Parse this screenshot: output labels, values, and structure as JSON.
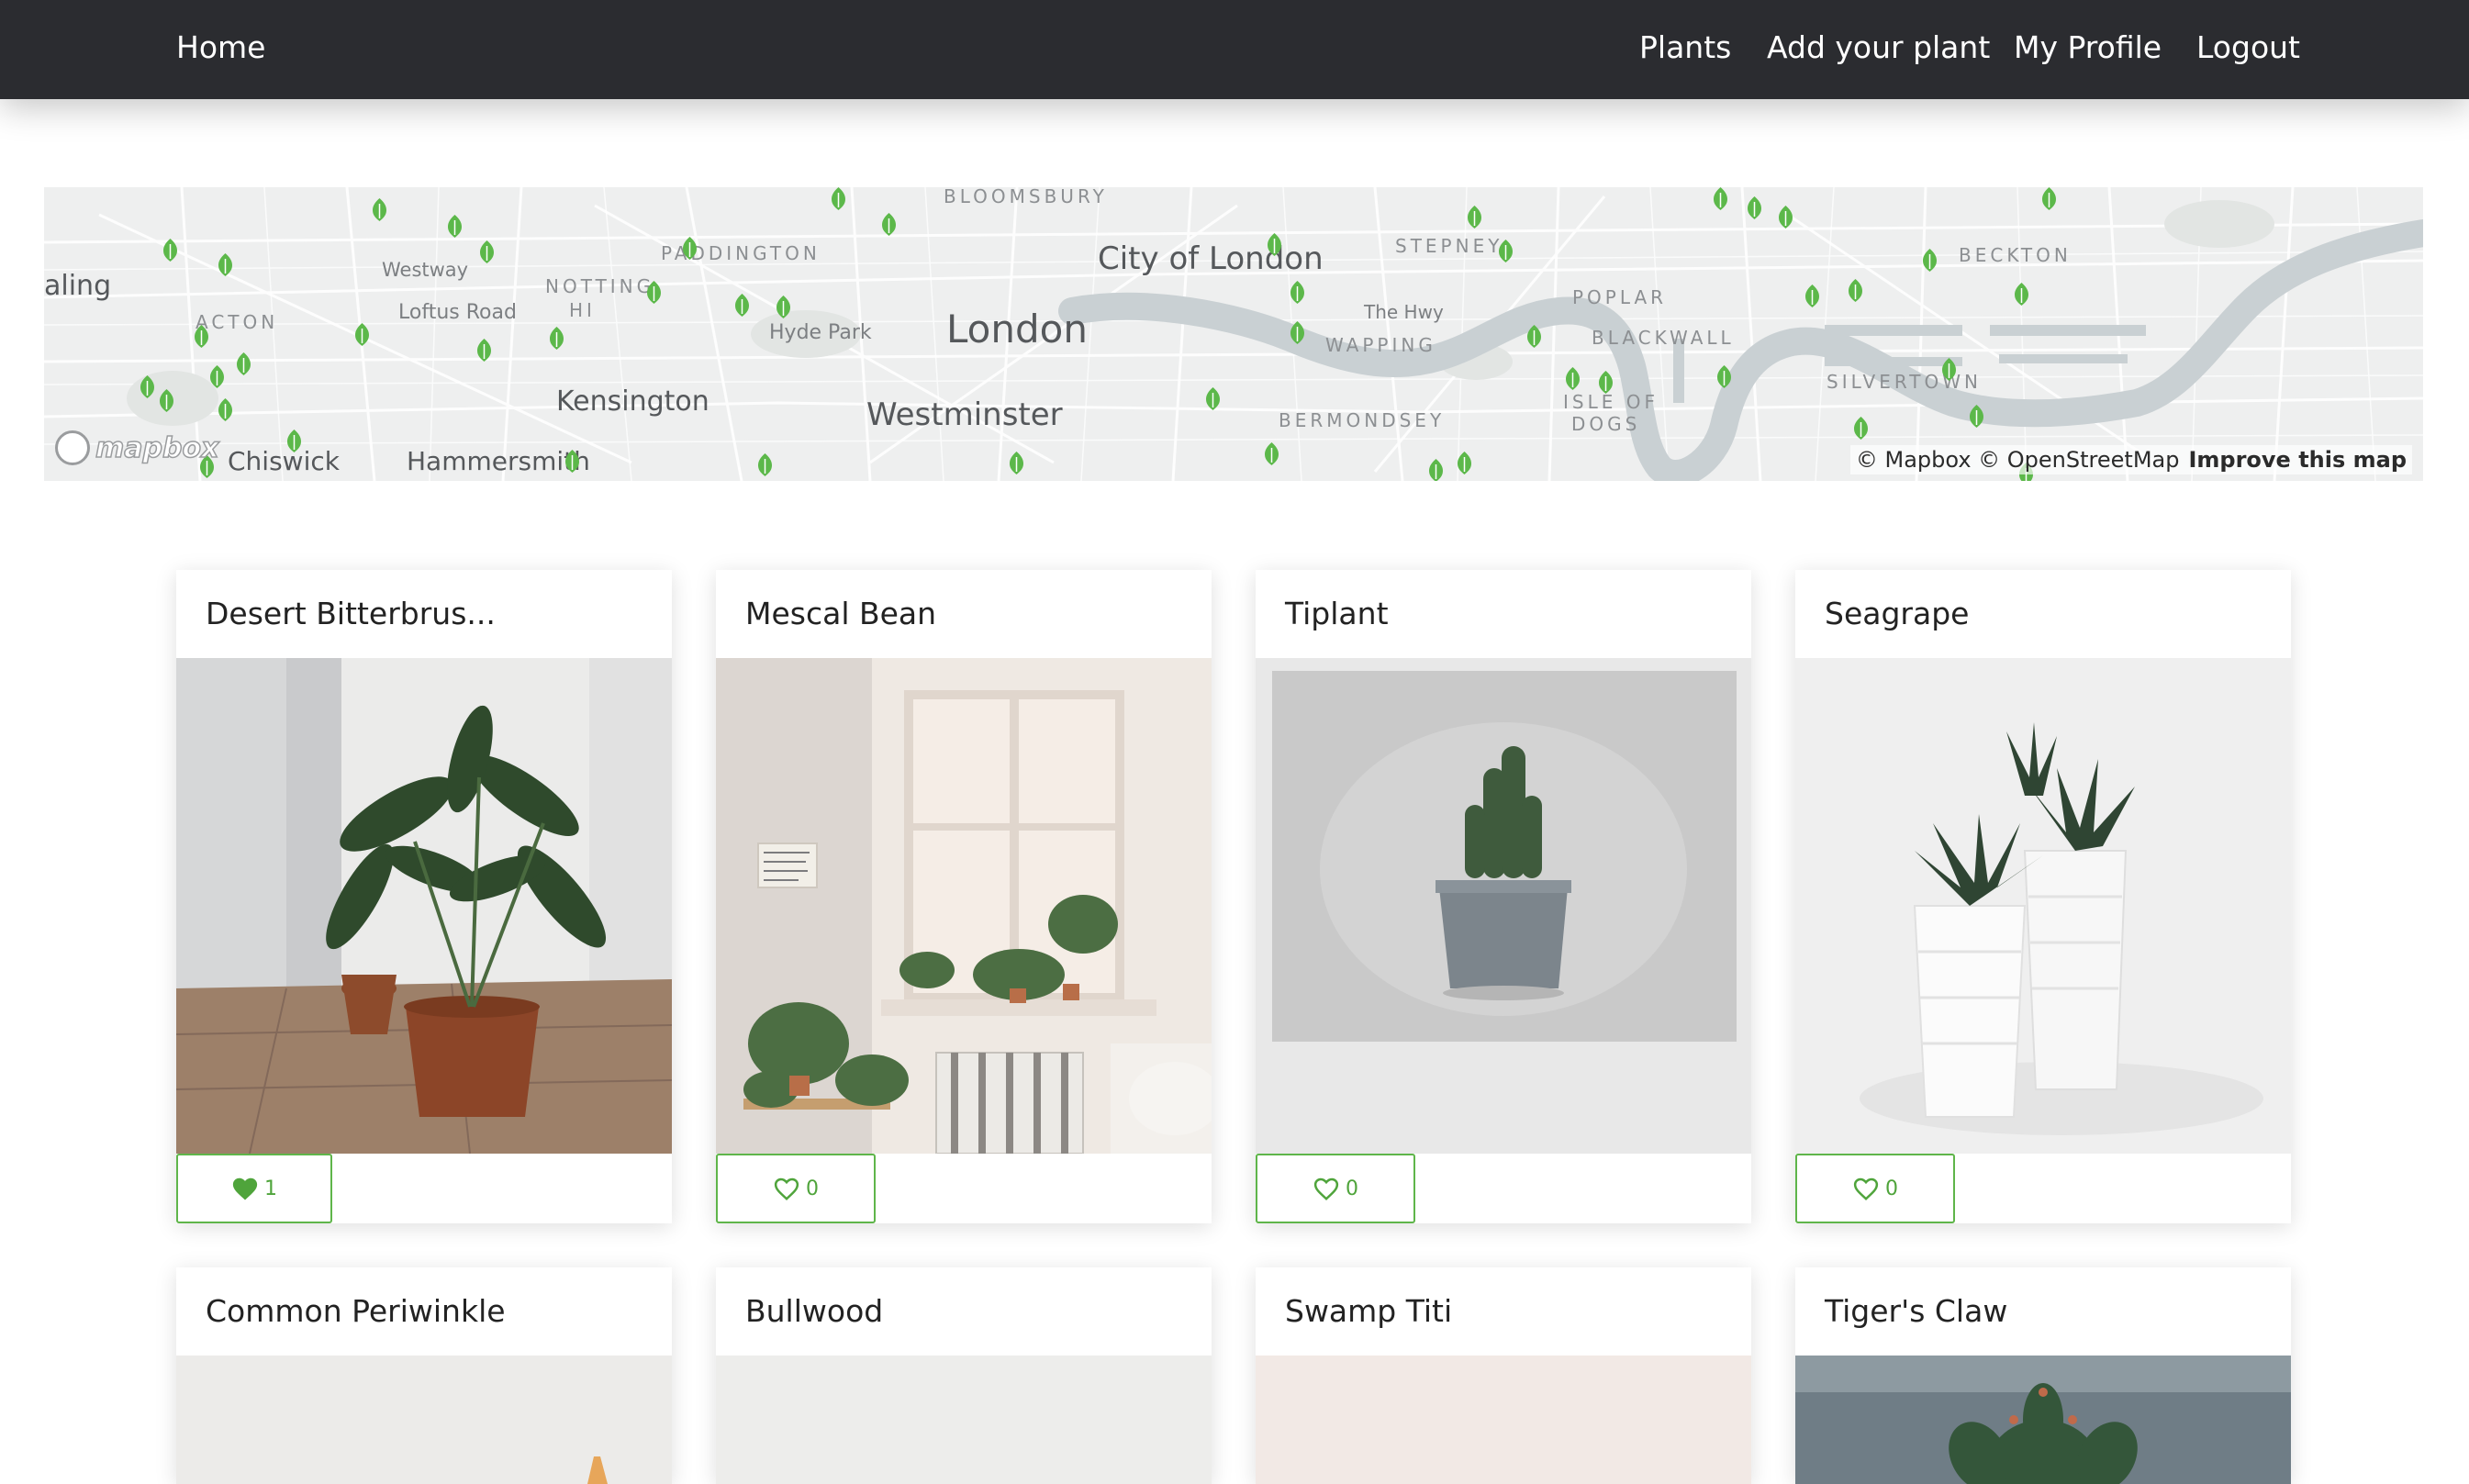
{
  "nav": {
    "home": "Home",
    "plants": "Plants",
    "add_plant": "Add your plant",
    "my_profile": "My Profile",
    "logout": "Logout"
  },
  "map": {
    "labels": {
      "london": "London",
      "city_of_london": "City of London",
      "westminster": "Westminster",
      "kensington": "Kensington",
      "hammersmith": "Hammersmith",
      "chiswick": "Chiswick",
      "ealing": "aling",
      "acton": "ACTON",
      "westway": "Westway",
      "loftus_road": "Loftus Road",
      "notting_hill_1": "NOTTING",
      "notting_hill_2": "HI",
      "paddington": "PADDINGTON",
      "bloomsbury": "BLOOMSBURY",
      "hyde_park": "Hyde Park",
      "stepney": "STEPNEY",
      "the_hwy": "The Hwy",
      "wapping": "WAPPING",
      "bermondsey": "BERMONDSEY",
      "poplar": "POPLAR",
      "blackwall": "BLACKWALL",
      "isle_of_dogs_1": "ISLE OF",
      "isle_of_dogs_2": "DOGS",
      "silvertown": "SILVERTOWN",
      "beckton": "BECKTON"
    },
    "logo": "mapbox",
    "attribution": "© Mapbox © OpenStreetMap",
    "improve_link": "Improve this map",
    "pin_color": "#5cb84a"
  },
  "plants": [
    {
      "name": "Desert Bitterbrus...",
      "likes": "1",
      "liked": true
    },
    {
      "name": "Mescal Bean",
      "likes": "0",
      "liked": false
    },
    {
      "name": "Tiplant",
      "likes": "0",
      "liked": false
    },
    {
      "name": "Seagrape",
      "likes": "0",
      "liked": false
    },
    {
      "name": "Common Periwinkle"
    },
    {
      "name": "Bullwood"
    },
    {
      "name": "Swamp Titi"
    },
    {
      "name": "Tiger's Claw"
    }
  ],
  "colors": {
    "navbar": "#2b2c30",
    "accent_green": "#5fb54a"
  },
  "icons": {
    "like": "heart-icon",
    "pin": "leaf-pin-icon"
  }
}
